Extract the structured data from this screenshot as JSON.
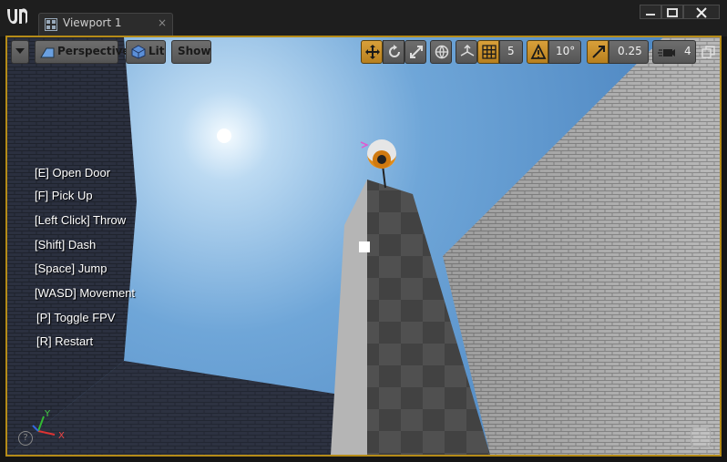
{
  "window": {
    "tab_label": "Viewport 1",
    "tab_close": "×"
  },
  "toolbar": {
    "perspective_label": "Perspective",
    "lit_label": "Lit",
    "show_label": "Show",
    "grid_snap_value": "5",
    "rotation_snap_value": "10°",
    "scale_snap_value": "0.25",
    "camera_speed_value": "4"
  },
  "hints": [
    "[E] Open Door",
    "[F] Pick Up",
    "[Left Click] Throw",
    "[Shift] Dash",
    "[Space] Jump",
    "[WASD] Movement",
    "[P] Toggle FPV",
    "[R] Restart"
  ],
  "axis": {
    "x_label": "X",
    "y_label": "Y"
  },
  "help_glyph": "?",
  "colors": {
    "selection_border": "#b58b18",
    "active_button": "#d8a03a"
  }
}
